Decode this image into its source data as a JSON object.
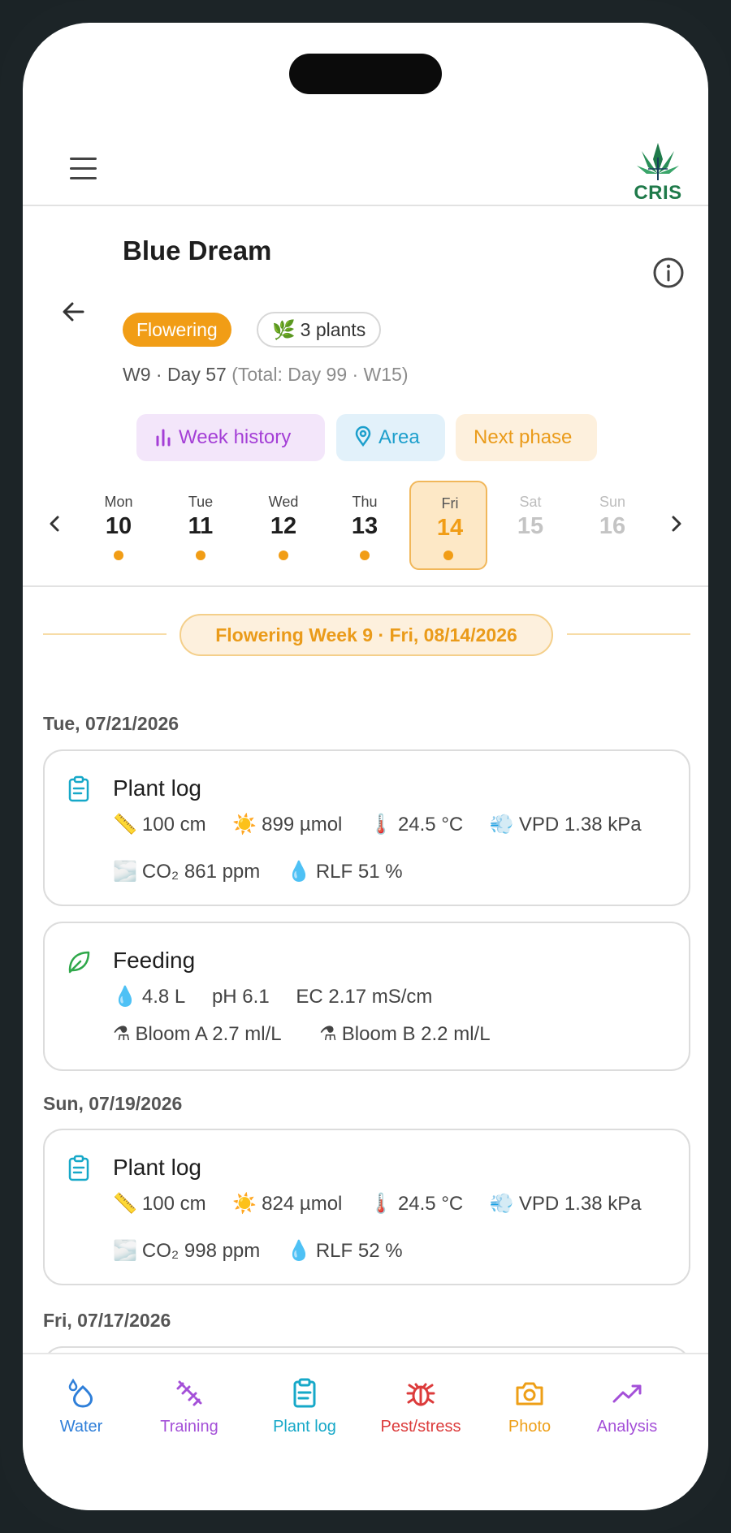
{
  "app": {
    "brand": "CRIS"
  },
  "plant": {
    "name": "Blue Dream",
    "phase": "Flowering",
    "plants": "3 plants",
    "week_day": "W9 · Day 57",
    "total": "(Total: Day 99 · W15)"
  },
  "actions": {
    "week_history": "Week history",
    "area": "Area",
    "next_phase": "Next phase"
  },
  "days": [
    {
      "name": "Mon",
      "num": "10"
    },
    {
      "name": "Tue",
      "num": "11"
    },
    {
      "name": "Wed",
      "num": "12"
    },
    {
      "name": "Thu",
      "num": "13"
    },
    {
      "name": "Fri",
      "num": "14"
    },
    {
      "name": "Sat",
      "num": "15"
    },
    {
      "name": "Sun",
      "num": "16"
    }
  ],
  "week_banner": "Flowering Week 9 · Fri, 08/14/2026",
  "entries": {
    "date1": "Tue, 07/21/2026",
    "log1": {
      "title": "Plant log",
      "height": "100 cm",
      "light": "899 µmol",
      "temp": "24.5 °C",
      "vpd": "VPD 1.38 kPa",
      "co2": "CO₂ 861 ppm",
      "rlf": "RLF 51 %"
    },
    "feed1": {
      "title": "Feeding",
      "water": "4.8 L",
      "ph": "pH 6.1",
      "ec": "EC 2.17 mS/cm",
      "nutrient_a": "Bloom A 2.7 ml/L",
      "nutrient_b": "Bloom B 2.2 ml/L"
    },
    "date2": "Sun, 07/19/2026",
    "log2": {
      "title": "Plant log",
      "height": "100 cm",
      "light": "824 µmol",
      "temp": "24.5 °C",
      "vpd": "VPD 1.38 kPa",
      "co2": "CO₂ 998 ppm",
      "rlf": "RLF 52 %"
    },
    "date3": "Fri, 07/17/2026"
  },
  "nav": {
    "water": "Water",
    "training": "Training",
    "plant_log": "Plant log",
    "pest": "Pest/stress",
    "photo": "Photo",
    "analysis": "Analysis"
  },
  "colors": {
    "accent": "#f19d16",
    "water": "#2f7fd9",
    "training": "#a450d8",
    "plant_log": "#16a8c8",
    "pest": "#dc3b3b",
    "photo": "#ee9f17",
    "analysis": "#a450d8"
  }
}
